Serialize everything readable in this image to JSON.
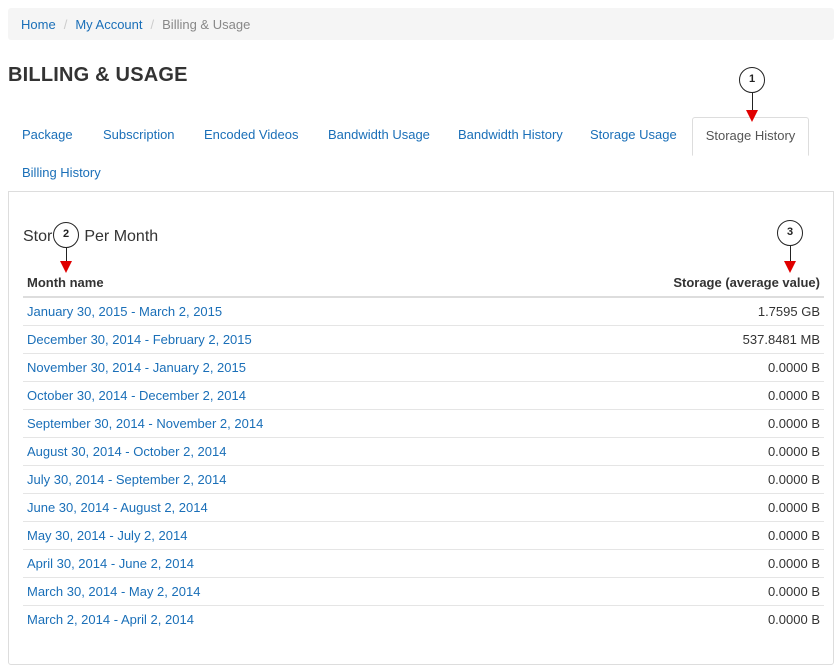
{
  "breadcrumb": {
    "home": "Home",
    "my_account": "My Account",
    "current": "Billing & Usage",
    "separator": "/"
  },
  "page_title": "BILLING & USAGE",
  "tabs": [
    {
      "label": "Package"
    },
    {
      "label": "Subscription"
    },
    {
      "label": "Encoded Videos"
    },
    {
      "label": "Bandwidth Usage"
    },
    {
      "label": "Bandwidth History"
    },
    {
      "label": "Storage Usage"
    },
    {
      "label": "Storage History"
    },
    {
      "label": "Billing History"
    }
  ],
  "active_tab": "Storage History",
  "panel": {
    "heading_left": "Stor",
    "heading_right": "Per Month"
  },
  "table": {
    "headers": {
      "month": "Month name",
      "storage": "Storage (average value)"
    },
    "rows": [
      {
        "month": "January 30, 2015 - March 2, 2015",
        "storage": "1.7595 GB"
      },
      {
        "month": "December 30, 2014 - February 2, 2015",
        "storage": "537.8481 MB"
      },
      {
        "month": "November 30, 2014 - January 2, 2015",
        "storage": "0.0000 B"
      },
      {
        "month": "October 30, 2014 - December 2, 2014",
        "storage": "0.0000 B"
      },
      {
        "month": "September 30, 2014 - November 2, 2014",
        "storage": "0.0000 B"
      },
      {
        "month": "August 30, 2014 - October 2, 2014",
        "storage": "0.0000 B"
      },
      {
        "month": "July 30, 2014 - September 2, 2014",
        "storage": "0.0000 B"
      },
      {
        "month": "June 30, 2014 - August 2, 2014",
        "storage": "0.0000 B"
      },
      {
        "month": "May 30, 2014 - July 2, 2014",
        "storage": "0.0000 B"
      },
      {
        "month": "April 30, 2014 - June 2, 2014",
        "storage": "0.0000 B"
      },
      {
        "month": "March 30, 2014 - May 2, 2014",
        "storage": "0.0000 B"
      },
      {
        "month": "March 2, 2014 - April 2, 2014",
        "storage": "0.0000 B"
      }
    ]
  },
  "callouts": [
    {
      "number": "1",
      "target": "Storage History tab"
    },
    {
      "number": "2",
      "target": "Month name column"
    },
    {
      "number": "3",
      "target": "Storage (average value) column"
    }
  ],
  "colors": {
    "link": "#1a6fb8",
    "arrow": "#e00000",
    "breadcrumb_bg": "#f5f5f5",
    "border": "#dddddd"
  }
}
